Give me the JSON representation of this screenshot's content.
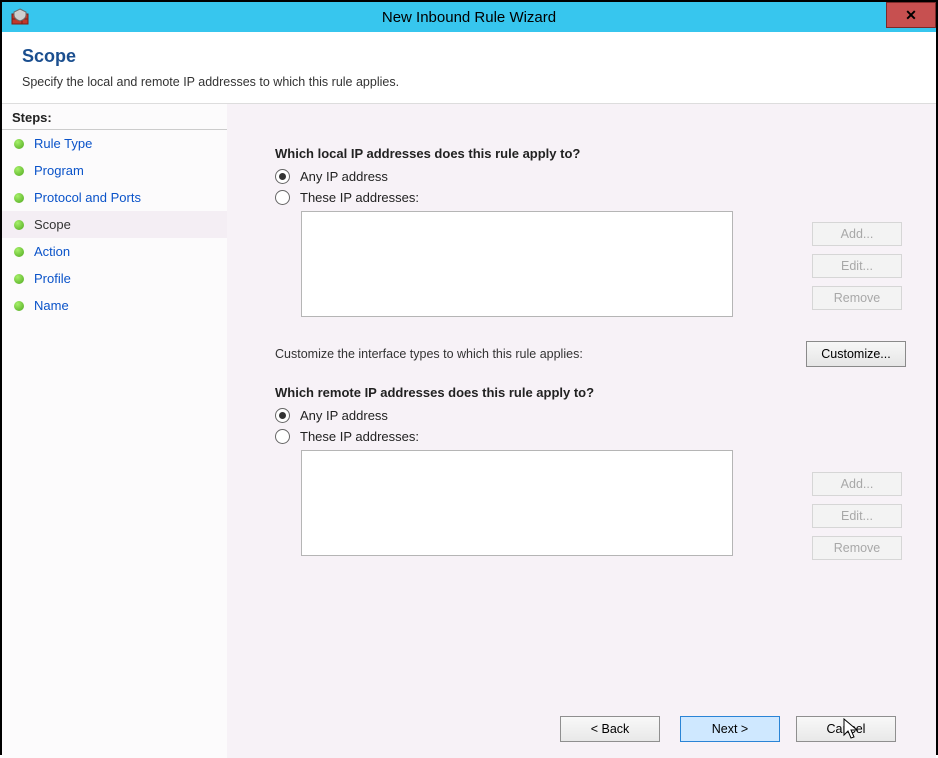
{
  "window": {
    "title": "New Inbound Rule Wizard",
    "close_glyph": "✕"
  },
  "header": {
    "title": "Scope",
    "subtitle": "Specify the local and remote IP addresses to which this rule applies."
  },
  "sidebar": {
    "header": "Steps:",
    "items": [
      {
        "label": "Rule Type",
        "current": false
      },
      {
        "label": "Program",
        "current": false
      },
      {
        "label": "Protocol and Ports",
        "current": false
      },
      {
        "label": "Scope",
        "current": true
      },
      {
        "label": "Action",
        "current": false
      },
      {
        "label": "Profile",
        "current": false
      },
      {
        "label": "Name",
        "current": false
      }
    ]
  },
  "main": {
    "local": {
      "question": "Which local IP addresses does this rule apply to?",
      "any_label": "Any IP address",
      "these_label": "These IP addresses:",
      "selected": "any",
      "list": [],
      "add_label": "Add...",
      "edit_label": "Edit...",
      "remove_label": "Remove"
    },
    "customize": {
      "text": "Customize the interface types to which this rule applies:",
      "button": "Customize..."
    },
    "remote": {
      "question": "Which remote IP addresses does this rule apply to?",
      "any_label": "Any IP address",
      "these_label": "These IP addresses:",
      "selected": "any",
      "list": [],
      "add_label": "Add...",
      "edit_label": "Edit...",
      "remove_label": "Remove"
    }
  },
  "footer": {
    "back": "< Back",
    "next": "Next >",
    "cancel": "Cancel"
  }
}
